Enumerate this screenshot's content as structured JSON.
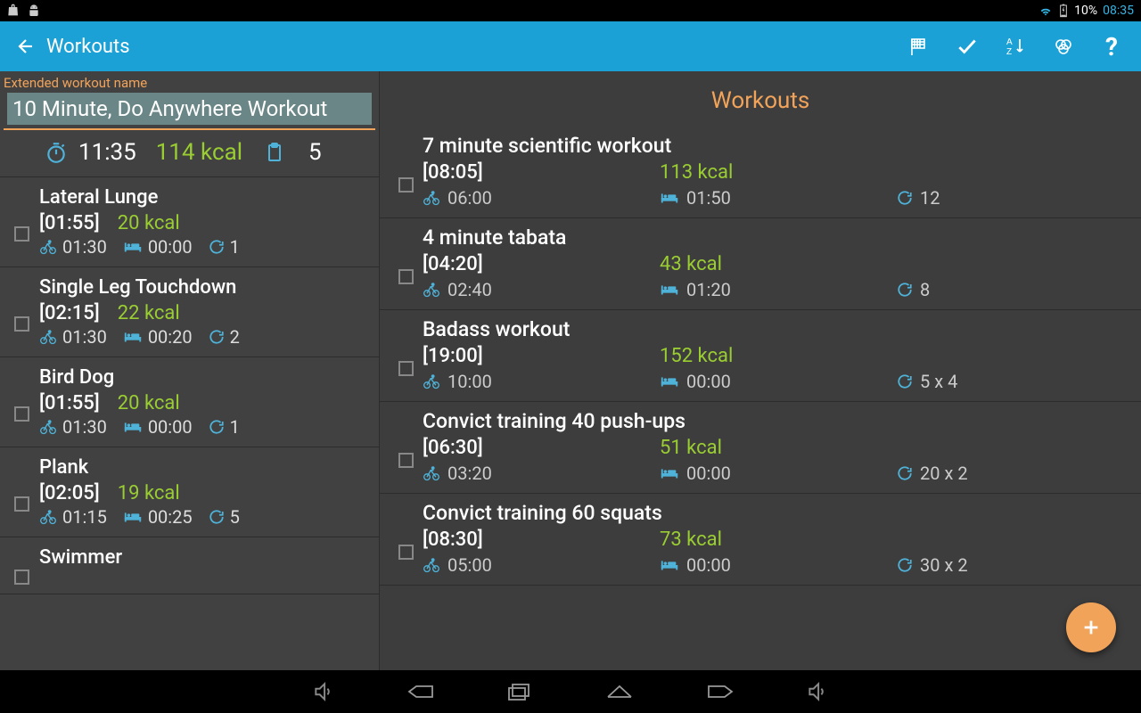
{
  "statusbar": {
    "battery_pct": "10%",
    "clock": "08:35"
  },
  "actionbar": {
    "title": "Workouts"
  },
  "left": {
    "extended_label": "Extended workout name",
    "name_value": "10 Minute, Do Anywhere Workout",
    "summary": {
      "time": "11:35",
      "kcal": "114 kcal",
      "count": "5"
    },
    "exercises": [
      {
        "name": "Lateral Lunge",
        "duration": "[01:55]",
        "kcal": "20 kcal",
        "active": "01:30",
        "rest": "00:00",
        "reps": "1"
      },
      {
        "name": "Single Leg Touchdown",
        "duration": "[02:15]",
        "kcal": "22 kcal",
        "active": "01:30",
        "rest": "00:20",
        "reps": "2"
      },
      {
        "name": "Bird Dog",
        "duration": "[01:55]",
        "kcal": "20 kcal",
        "active": "01:30",
        "rest": "00:00",
        "reps": "1"
      },
      {
        "name": "Plank",
        "duration": "[02:05]",
        "kcal": "19 kcal",
        "active": "01:15",
        "rest": "00:25",
        "reps": "5"
      },
      {
        "name": "Swimmer",
        "duration": "",
        "kcal": "",
        "active": "",
        "rest": "",
        "reps": ""
      }
    ]
  },
  "right": {
    "title": "Workouts",
    "workouts": [
      {
        "name": "7 minute scientific workout",
        "duration": "[08:05]",
        "kcal": "113 kcal",
        "active": "06:00",
        "rest": "01:50",
        "reps": "12"
      },
      {
        "name": "4 minute tabata",
        "duration": "[04:20]",
        "kcal": "43 kcal",
        "active": "02:40",
        "rest": "01:20",
        "reps": "8"
      },
      {
        "name": "Badass workout",
        "duration": "[19:00]",
        "kcal": "152 kcal",
        "active": "10:00",
        "rest": "00:00",
        "reps": "5 x 4"
      },
      {
        "name": "Convict training 40 push-ups",
        "duration": "[06:30]",
        "kcal": "51 kcal",
        "active": "03:20",
        "rest": "00:00",
        "reps": "20 x 2"
      },
      {
        "name": "Convict training 60 squats",
        "duration": "[08:30]",
        "kcal": "73 kcal",
        "active": "05:00",
        "rest": "00:00",
        "reps": "30 x 2"
      }
    ]
  }
}
